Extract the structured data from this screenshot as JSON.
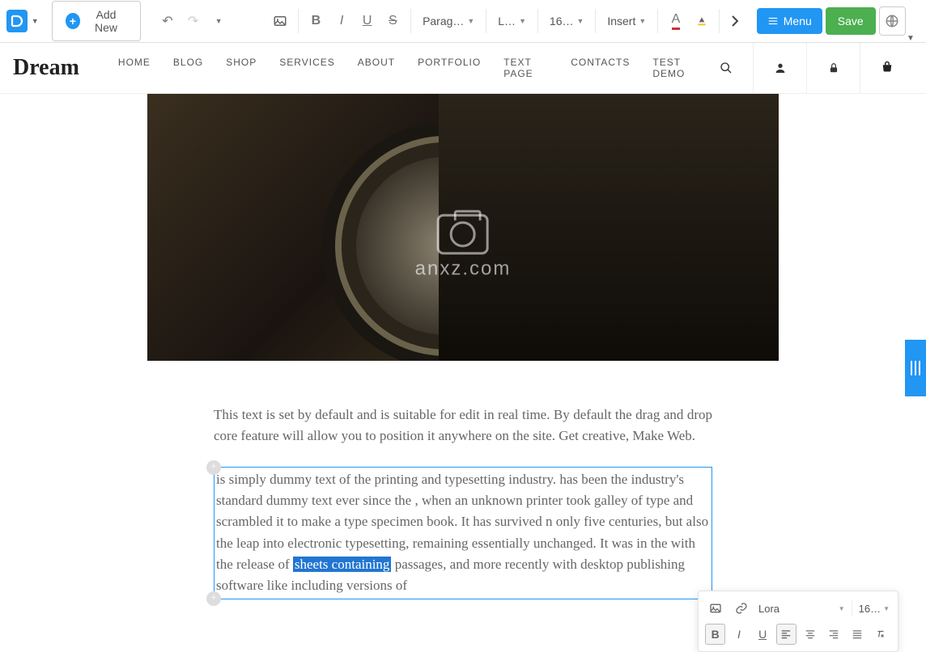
{
  "toolbar": {
    "add_new": "Add New",
    "paragraph": "Parag…",
    "font": "L…",
    "size": "16…",
    "insert": "Insert",
    "menu": "Menu",
    "save": "Save"
  },
  "nav": {
    "brand": "Dream",
    "items": [
      "HOME",
      "BLOG",
      "SHOP",
      "SERVICES",
      "ABOUT",
      "PORTFOLIO",
      "TEXT PAGE",
      "CONTACTS",
      "TEST DEMO"
    ]
  },
  "content": {
    "watermark": "anxz.com",
    "intro": "This text is set by default and is suitable for edit in real time. By default the drag and drop core feature will allow you to position it anywhere on the site. Get creative, Make Web.",
    "editable_pre": "is simply dummy text of the printing and typesetting industry. has been the industry's standard dummy text ever since the , when an unknown printer took galley of type and scrambled it to make a type specimen book. It has survived n only five centuries, but also the leap into electronic typesetting, remaining essentially unchanged. It was  in the  with the release of ",
    "editable_highlight": "sheets containing",
    "editable_post": " passages, and more recently with desktop publishing software like  including versions of"
  },
  "float_toolbar": {
    "font": "Lora",
    "size": "16…"
  }
}
